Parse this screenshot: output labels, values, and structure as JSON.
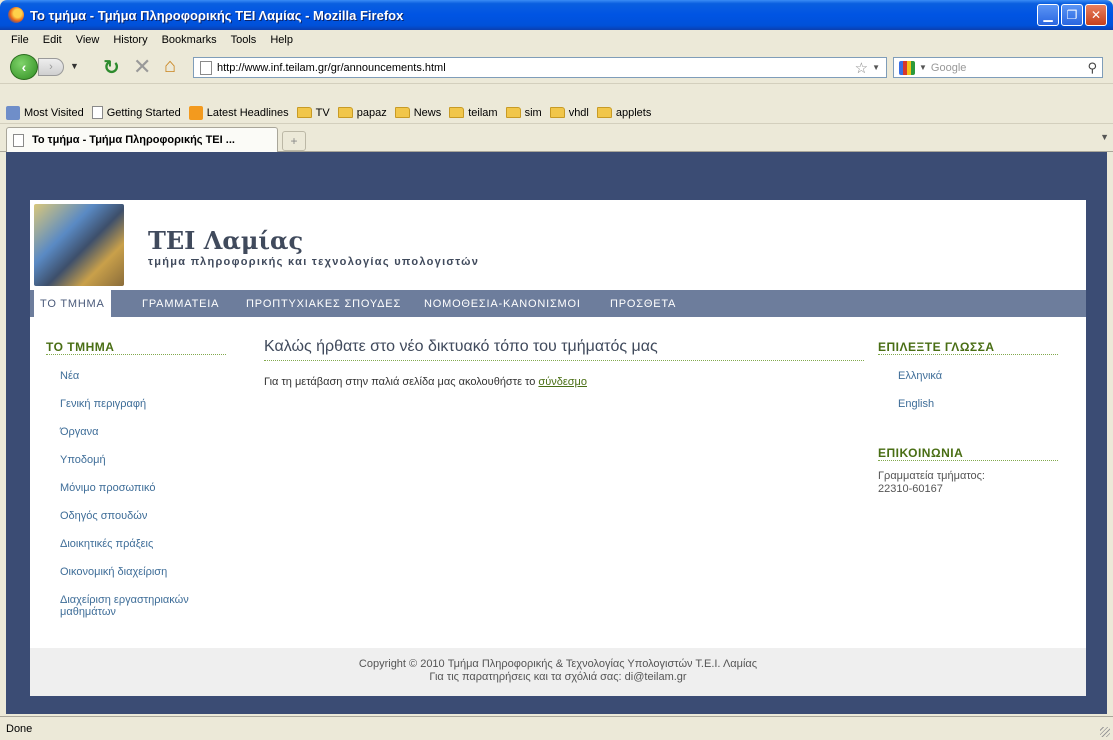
{
  "window": {
    "title": "Το τμήμα - Τμήμα Πληροφορικής ΤΕΙ Λαμίας - Mozilla Firefox",
    "minimize": "▁",
    "maximize": "❐",
    "close": "✕"
  },
  "menu": [
    "File",
    "Edit",
    "View",
    "History",
    "Bookmarks",
    "Tools",
    "Help"
  ],
  "nav": {
    "back": "‹",
    "forward": "›",
    "dropdown": "▼",
    "url": "http://www.inf.teilam.gr/gr/announcements.html",
    "search_placeholder": "Google"
  },
  "bookmarks": [
    {
      "label": "Most Visited",
      "icon": "most-visited"
    },
    {
      "label": "Getting Started",
      "icon": "page"
    },
    {
      "label": "Latest Headlines",
      "icon": "rss"
    },
    {
      "label": "TV",
      "icon": "folder"
    },
    {
      "label": "papaz",
      "icon": "folder"
    },
    {
      "label": "News",
      "icon": "folder"
    },
    {
      "label": "teilam",
      "icon": "folder"
    },
    {
      "label": "sim",
      "icon": "folder"
    },
    {
      "label": "vhdl",
      "icon": "folder"
    },
    {
      "label": "applets",
      "icon": "folder"
    }
  ],
  "tab": {
    "label": "Το τμήμα - Τμήμα Πληροφορικής ΤΕΙ ...",
    "new_tab": "+"
  },
  "site": {
    "title": "ΤΕΙ Λαμίας",
    "subtitle": "τμήμα πληροφορικής και τεχνολογίας υπολογιστών",
    "nav": [
      "Το τμημα",
      "Γραμματεια",
      "Προπτυχιακες σπουδες",
      "Νομοθεσια-Κανονισμοι",
      "Προσθετα"
    ],
    "left": {
      "title": "ΤΟ ΤΜΗΜΑ",
      "links": [
        "Νέα",
        "Γενική περιγραφή",
        "Όργανα",
        "Υποδομή",
        "Μόνιμο προσωπικό",
        "Οδηγός σπουδών",
        "Διοικητικές πράξεις",
        "Οικονομική διαχείριση",
        "Διαχείριση εργαστηριακών",
        "μαθημάτων"
      ]
    },
    "main": {
      "title": "Καλώς ήρθατε στο νέο δικτυακό τόπο του τμήματός μας",
      "text": "Για τη μετάβαση στην παλιά σελίδα μας ακολουθήστε το",
      "link": "σύνδεσμο"
    },
    "right": {
      "lang_title": "Επιλεξτε Γλωσσα",
      "languages": [
        "Ελληνικά",
        "English"
      ],
      "contact_title": "Επικοινωνια",
      "contact_line1": "Γραμματεία τμήματος:",
      "contact_line2": "22310-60167"
    },
    "footer": {
      "line1": "Copyright © 2010 Τμήμα Πληροφορικής & Τεχνολογίας Υπολογιστών Τ.Ε.Ι. Λαμίας",
      "line2": "Για τις παρατηρήσεις και τα σχόλιά σας: di@teilam.gr"
    }
  },
  "status": {
    "text": "Done"
  }
}
